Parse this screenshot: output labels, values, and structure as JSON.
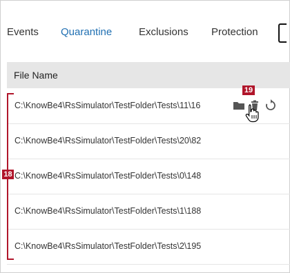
{
  "tabs": [
    {
      "label": "Events",
      "active": false
    },
    {
      "label": "Quarantine",
      "active": true
    },
    {
      "label": "Exclusions",
      "active": false
    },
    {
      "label": "Protection",
      "active": false
    }
  ],
  "table": {
    "header": "File Name",
    "rows": [
      {
        "path": "C:\\KnowBe4\\RsSimulator\\TestFolder\\Tests\\11\\16"
      },
      {
        "path": "C:\\KnowBe4\\RsSimulator\\TestFolder\\Tests\\20\\82"
      },
      {
        "path": "C:\\KnowBe4\\RsSimulator\\TestFolder\\Tests\\0\\148"
      },
      {
        "path": "C:\\KnowBe4\\RsSimulator\\TestFolder\\Tests\\1\\188"
      },
      {
        "path": "C:\\KnowBe4\\RsSimulator\\TestFolder\\Tests\\2\\195"
      }
    ],
    "row_actions": [
      "folder-icon",
      "trash-icon",
      "restore-icon"
    ]
  },
  "annotations": {
    "rows_marker": "18",
    "delete_marker": "19",
    "color": "#b0152a"
  },
  "colors": {
    "active_tab": "#1f6fb2",
    "header_bg": "#e6e6e6",
    "icon": "#555555"
  }
}
